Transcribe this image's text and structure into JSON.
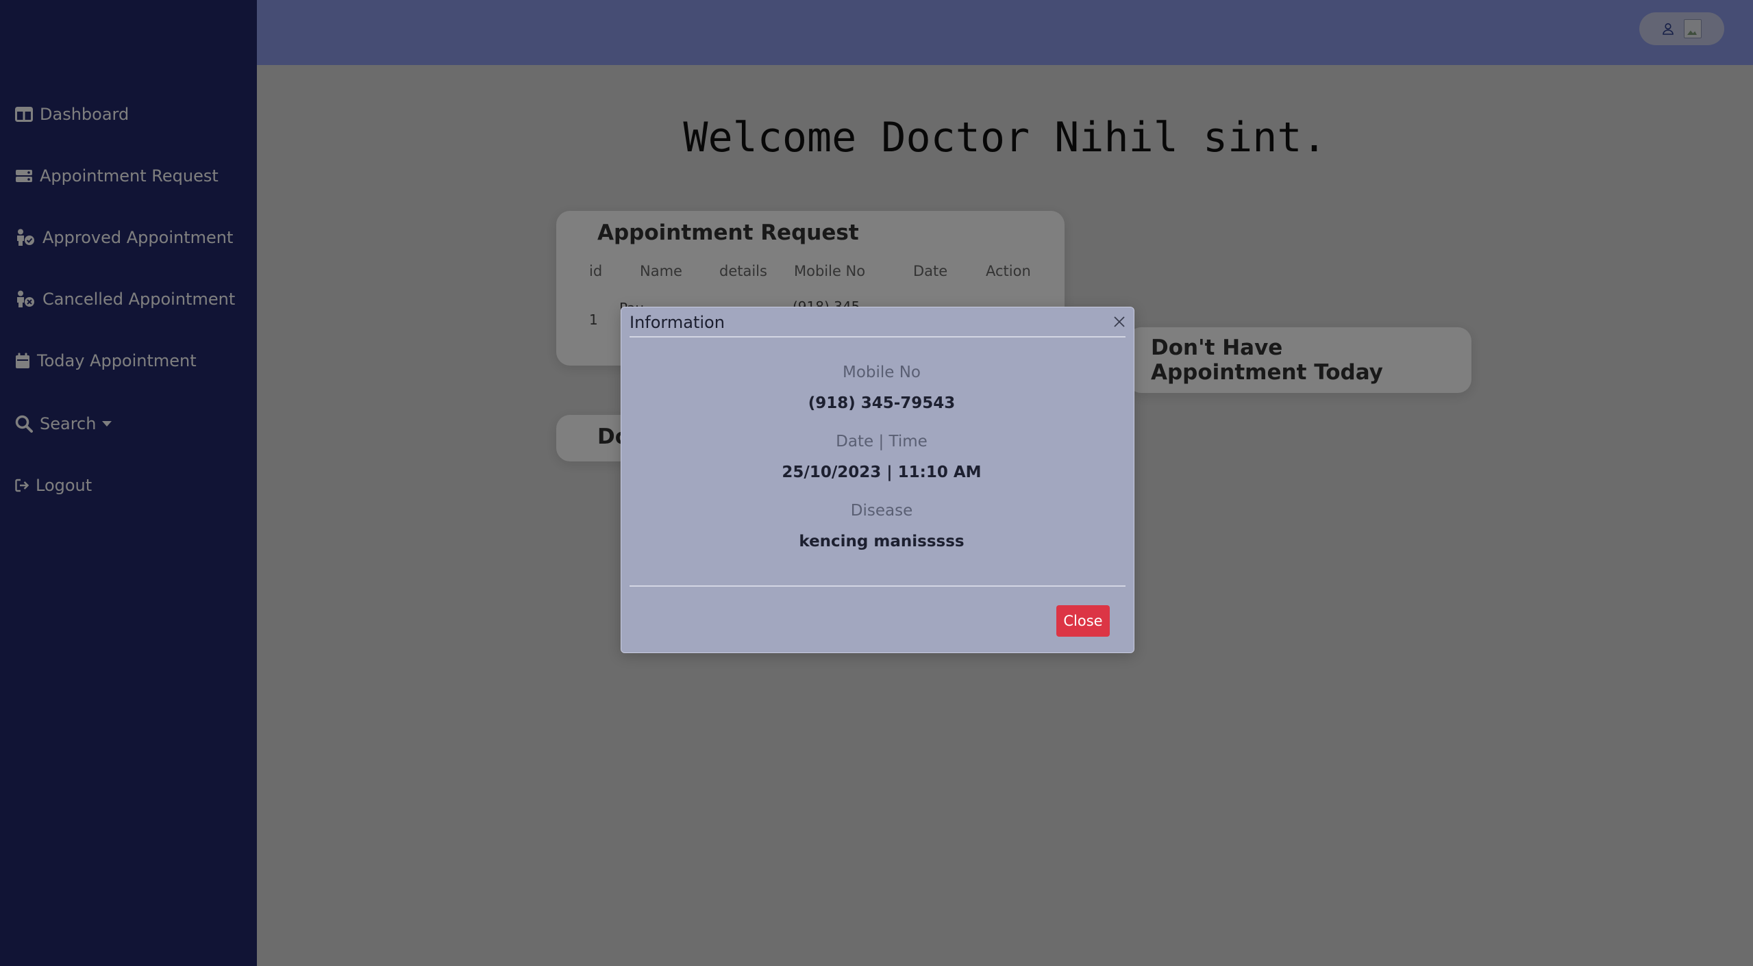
{
  "sidebar": {
    "items": [
      {
        "label": "Dashboard",
        "icon": "dashboard-icon"
      },
      {
        "label": "Appointment Request",
        "icon": "appointment-request-icon"
      },
      {
        "label": "Approved Appointment",
        "icon": "approved-appointment-icon"
      },
      {
        "label": "Cancelled Appointment",
        "icon": "cancelled-appointment-icon"
      },
      {
        "label": "Today Appointment",
        "icon": "calendar-icon"
      },
      {
        "label": "Search",
        "icon": "search-icon"
      },
      {
        "label": "Logout",
        "icon": "logout-icon"
      }
    ]
  },
  "header": {
    "user_icon": "user-icon"
  },
  "main": {
    "welcome": "Welcome Doctor Nihil sint.",
    "appointment_request": {
      "title": "Appointment Request",
      "columns": [
        "id",
        "Name",
        "details",
        "Mobile No",
        "Date",
        "Action"
      ],
      "rows": [
        {
          "id": "1",
          "name": "Pau",
          "mobile": "(918) 345-"
        }
      ]
    },
    "today_card": {
      "title": "Don't Have Appointment Today"
    },
    "second_card": {
      "title": "Do"
    }
  },
  "modal": {
    "title": "Information",
    "fields": [
      {
        "label": "Mobile No",
        "value": "(918) 345-79543"
      },
      {
        "label": "Date | Time",
        "value": "25/10/2023 | 11:10 AM"
      },
      {
        "label": "Disease",
        "value": "kencing manisssss"
      }
    ],
    "close_label": "Close"
  },
  "colors": {
    "sidebar": "#23296b",
    "topbar": "#8c9ae8",
    "danger": "#dc3545"
  }
}
